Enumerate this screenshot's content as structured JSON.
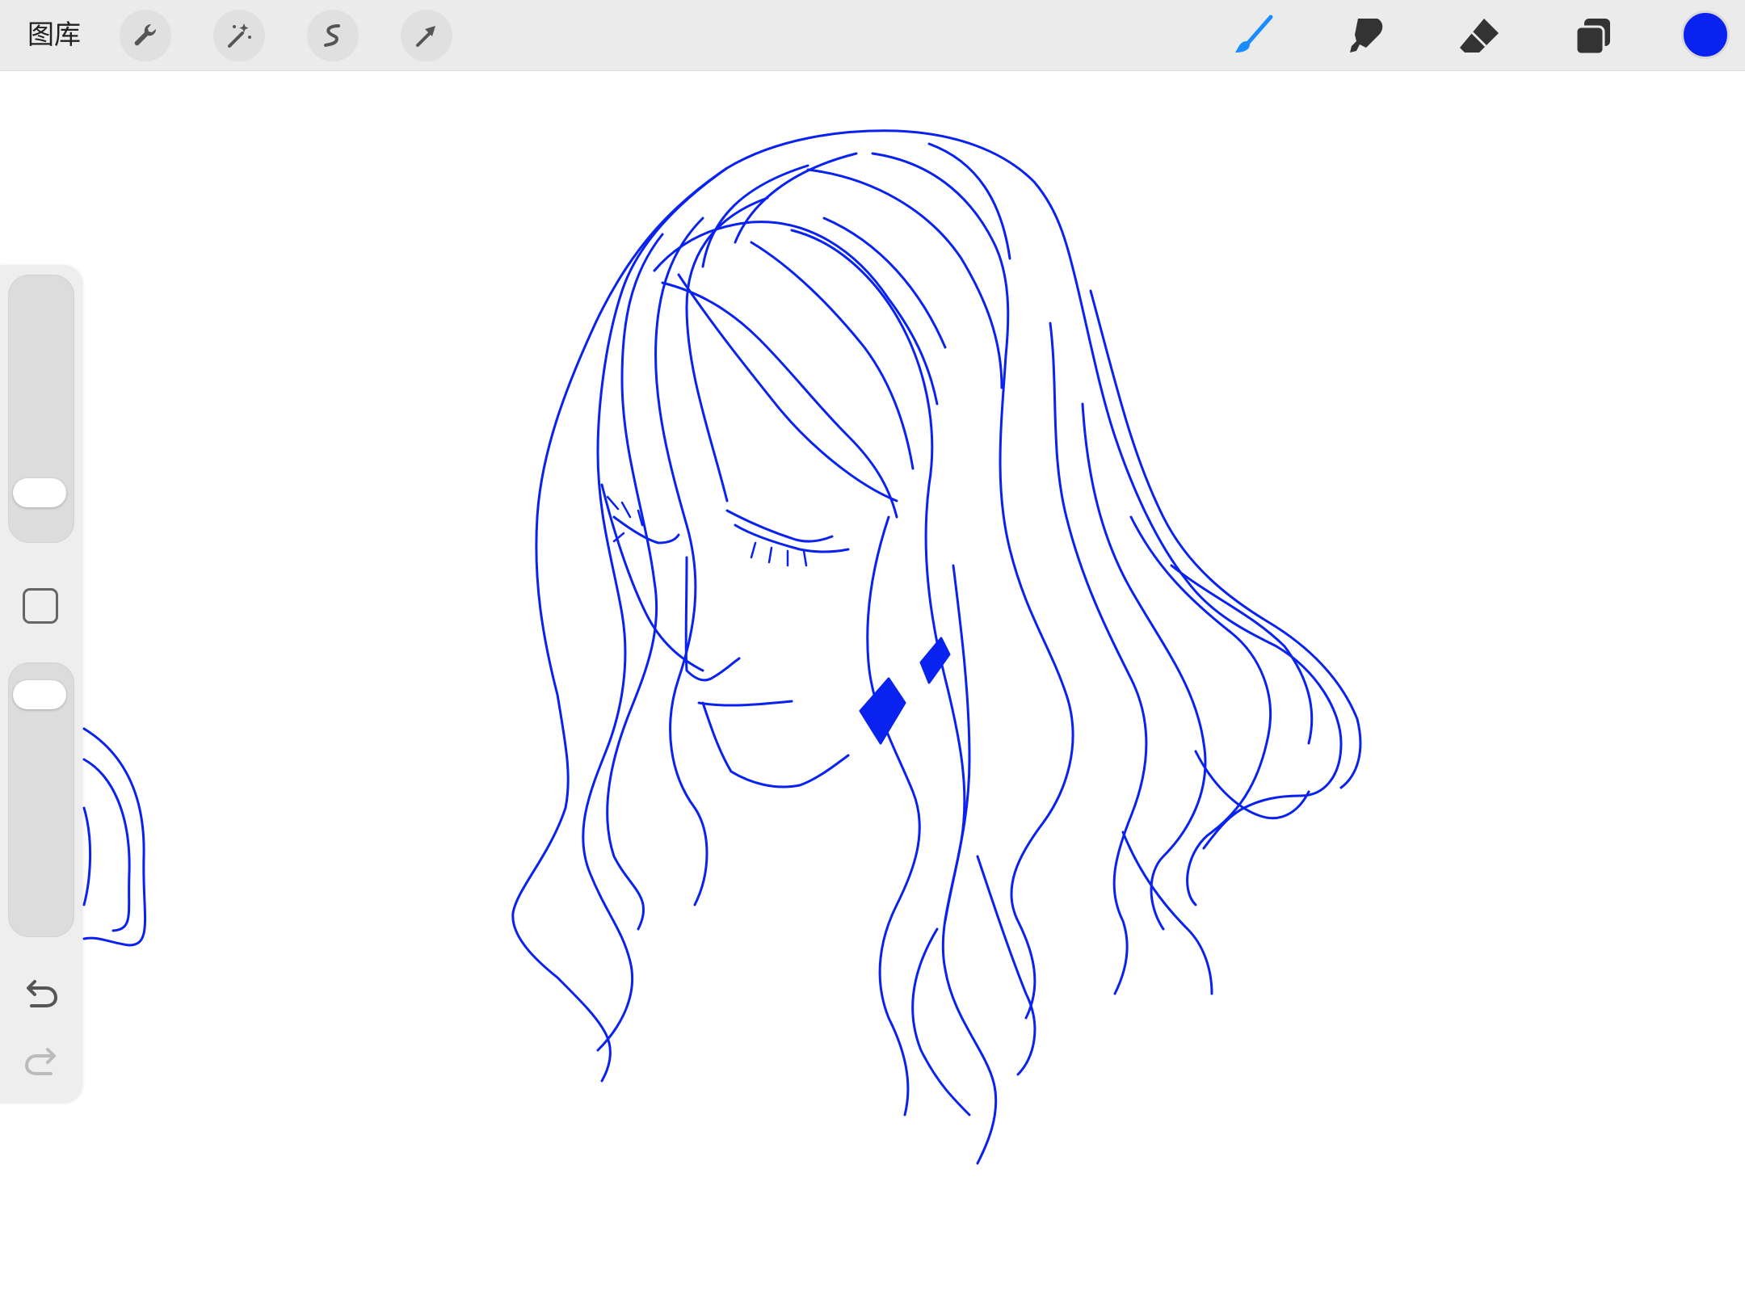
{
  "toolbar": {
    "gallery_label": "图库",
    "left_tools": [
      "wrench-icon",
      "magic-wand-icon",
      "selection-icon",
      "transform-arrow-icon"
    ],
    "right_tools": [
      "brush-icon",
      "smudge-icon",
      "eraser-icon",
      "layers-icon"
    ],
    "active_tool": "brush",
    "accent_color": "#1a8cff",
    "current_color": "#0a22f0"
  },
  "sidebar": {
    "brush_size_level": 0.14,
    "opacity_level": 0.94
  },
  "canvas": {
    "stroke_color": "#0a22f0",
    "background": "#ffffff"
  }
}
